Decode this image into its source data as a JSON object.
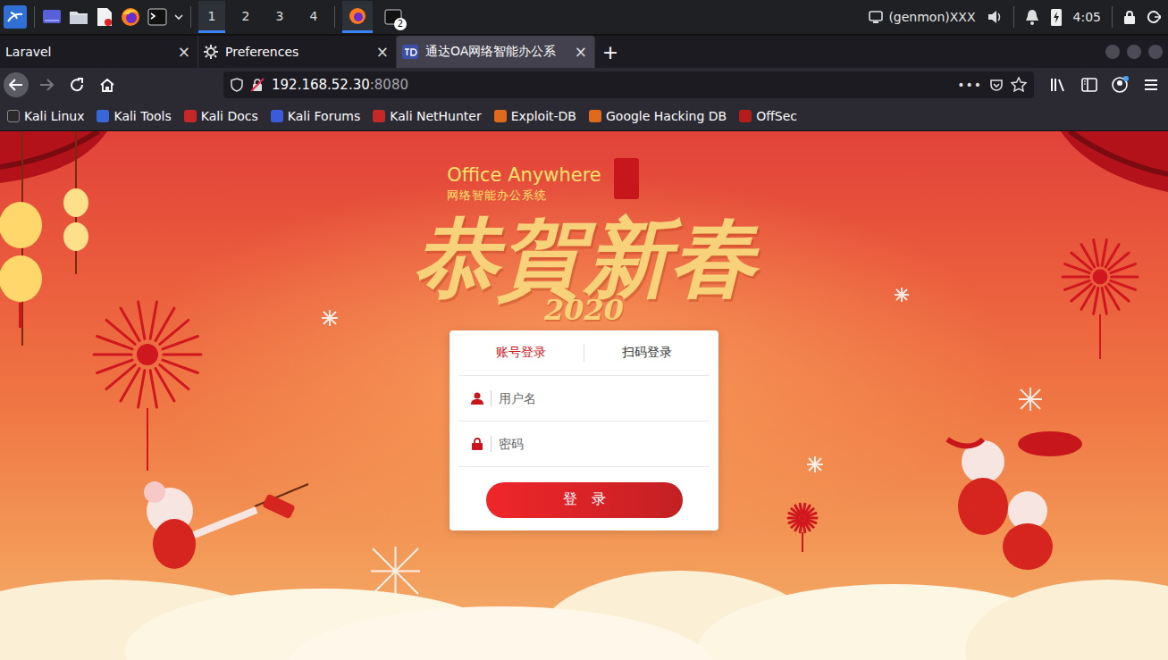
{
  "panel": {
    "workspaces": [
      {
        "label": "1",
        "selected": true
      },
      {
        "label": "2",
        "selected": false
      },
      {
        "label": "3",
        "selected": false
      },
      {
        "label": "4",
        "selected": false
      }
    ],
    "terminal_badge": "2",
    "genmon": "(genmon)XXX",
    "clock": "4:05"
  },
  "tabs": [
    {
      "label": "Laravel",
      "close": "×",
      "selected": false
    },
    {
      "label": "Preferences",
      "close": "×",
      "selected": false
    },
    {
      "label": "通达OA网络智能办公系",
      "close": "×",
      "selected": true
    }
  ],
  "new_tab": "+",
  "nav": {
    "back_enabled": true,
    "forward_enabled": false
  },
  "address": {
    "host": "192.168.52.30",
    "port": ":8080",
    "menu": "•••"
  },
  "bookmarks": [
    "Kali Linux",
    "Kali Tools",
    "Kali Docs",
    "Kali Forums",
    "Kali NetHunter",
    "Exploit-DB",
    "Google Hacking DB",
    "OffSec"
  ],
  "page": {
    "brand": "Office Anywhere",
    "brand_sub": "网络智能办公系统",
    "greeting": "恭賀新春",
    "year": "2020",
    "login": {
      "tabs": [
        {
          "label": "账号登录",
          "selected": true
        },
        {
          "label": "扫码登录",
          "selected": false
        }
      ],
      "username_placeholder": "用户名",
      "password_placeholder": "密码",
      "submit": "登　录"
    }
  }
}
